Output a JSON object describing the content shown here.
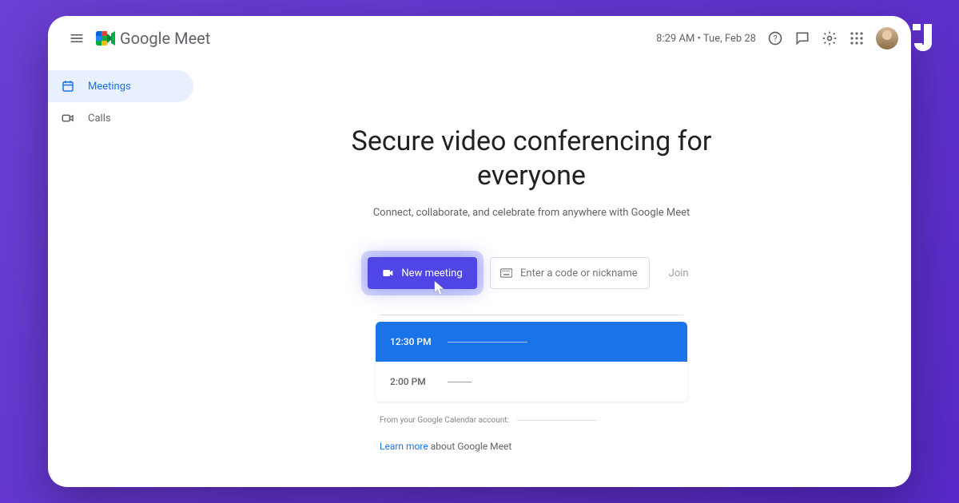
{
  "header": {
    "app_name_prefix": "Google",
    "app_name_suffix": "Meet",
    "time": "8:29 AM",
    "separator": "•",
    "date": "Tue, Feb 28"
  },
  "sidebar": {
    "items": [
      {
        "label": "Meetings"
      },
      {
        "label": "Calls"
      }
    ]
  },
  "main": {
    "headline": "Secure video conferencing for everyone",
    "subtext": "Connect, collaborate, and celebrate from anywhere with Google Meet",
    "new_meeting_label": "New meeting",
    "code_input_placeholder": "Enter a code or nickname",
    "join_label": "Join",
    "meetings": [
      {
        "time": "12:30 PM"
      },
      {
        "time": "2:00 PM"
      }
    ],
    "calendar_note": "From your Google Calendar account:",
    "learn_more_link": "Learn more",
    "learn_more_rest": " about Google Meet"
  }
}
